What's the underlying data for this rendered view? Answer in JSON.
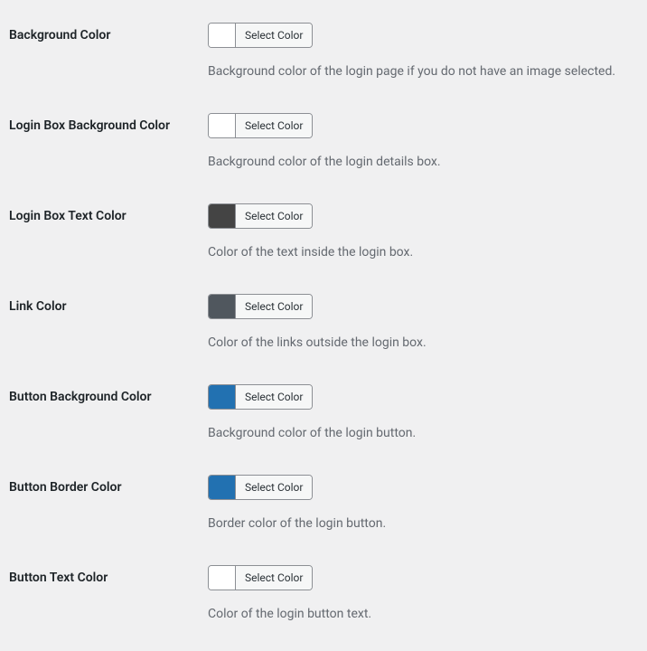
{
  "selectColorLabel": "Select Color",
  "fields": [
    {
      "label": "Background Color",
      "name": "background-color",
      "swatch": "#ffffff",
      "description": "Background color of the login page if you do not have an image selected."
    },
    {
      "label": "Login Box Background Color",
      "name": "login-box-background-color",
      "swatch": "#ffffff",
      "description": "Background color of the login details box."
    },
    {
      "label": "Login Box Text Color",
      "name": "login-box-text-color",
      "swatch": "#444444",
      "description": "Color of the text inside the login box."
    },
    {
      "label": "Link Color",
      "name": "link-color",
      "swatch": "#50575e",
      "description": "Color of the links outside the login box."
    },
    {
      "label": "Button Background Color",
      "name": "button-background-color",
      "swatch": "#2271b1",
      "description": "Background color of the login button."
    },
    {
      "label": "Button Border Color",
      "name": "button-border-color",
      "swatch": "#2271b1",
      "description": "Border color of the login button."
    },
    {
      "label": "Button Text Color",
      "name": "button-text-color",
      "swatch": "#ffffff",
      "description": "Color of the login button text."
    }
  ]
}
